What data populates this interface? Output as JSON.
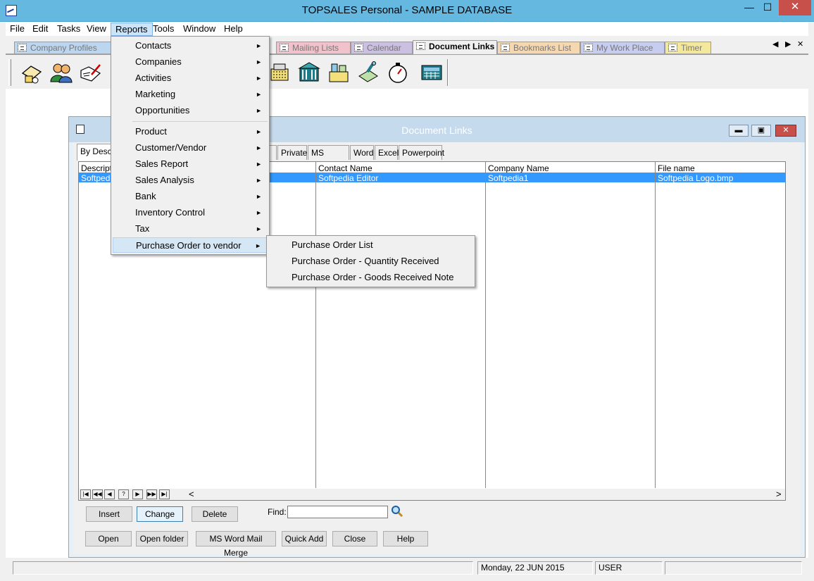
{
  "window": {
    "title": "TOPSALES Personal - SAMPLE DATABASE",
    "min": "—",
    "max": "☐",
    "close": "✕"
  },
  "menubar": [
    "File",
    "Edit",
    "Tasks",
    "View",
    "Reports",
    "Tools",
    "Window",
    "Help"
  ],
  "main_tabs": [
    "Company Profiles",
    "Mailing Lists",
    "Calendar",
    "Document Links",
    "Bookmarks List",
    "My Work Place",
    "Timer"
  ],
  "tab_nav": {
    "prev": "◀",
    "next": "▶",
    "close": "✕"
  },
  "reports_menu": {
    "items": [
      "Contacts",
      "Companies",
      "Activities",
      "Marketing",
      "Opportunities",
      "Product",
      "Customer/Vendor",
      "Sales Report",
      "Sales Analysis",
      "Bank",
      "Inventory Control",
      "Tax",
      "Purchase Order to vendor"
    ],
    "submenu_arrow": "►"
  },
  "po_submenu": [
    "Purchase Order List",
    "Purchase Order - Quantity Received",
    "Purchase Order - Goods Received Note"
  ],
  "doc_window": {
    "title": "Document Links",
    "buttons": {
      "min": "▬",
      "max": "▣",
      "close": "✕"
    },
    "tabs": [
      "By Descr",
      "c",
      "Private",
      "MS Office",
      "Word",
      "Excel",
      "Powerpoint"
    ],
    "columns": [
      "Descripti",
      "Contact Name",
      "Company Name",
      "File name"
    ],
    "rows": [
      {
        "description": "Softpedi",
        "contact": "Softpedia Editor",
        "company": "Softpedia1",
        "file": "Softpedia Logo.bmp"
      }
    ],
    "nav": [
      "|◀",
      "◀◀",
      "◀",
      "?",
      "▶",
      "▶▶",
      "▶|"
    ],
    "scroll": {
      "left": "<",
      "right": ">"
    },
    "actions": [
      "Insert",
      "Change",
      "Delete"
    ],
    "find_label": "Find:",
    "find_value": "",
    "bottom_buttons": [
      "Open",
      "Open folder",
      "MS Word Mail Merge",
      "Quick Add",
      "Close",
      "Help"
    ]
  },
  "status": {
    "date": "Monday, 22 JUN 2015",
    "user": "USER"
  }
}
